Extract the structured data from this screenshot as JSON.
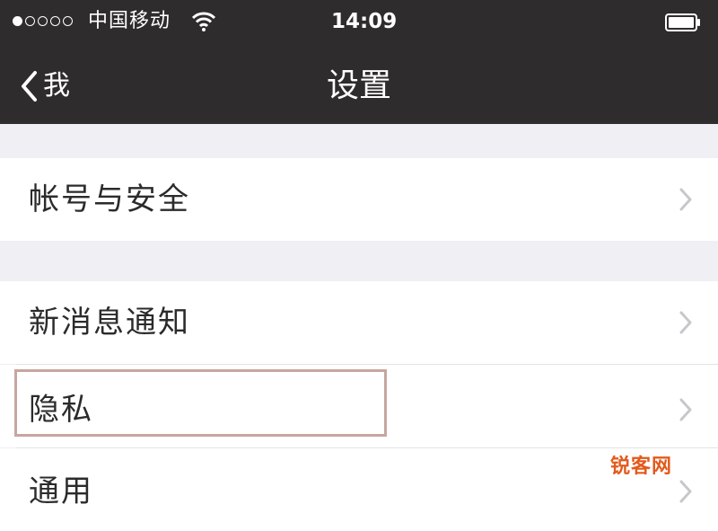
{
  "status_bar": {
    "carrier": "中国移动",
    "time": "14:09",
    "signal_filled": 1,
    "signal_total": 5
  },
  "nav": {
    "back_label": "我",
    "title": "设置"
  },
  "settings": {
    "items": [
      {
        "label": "帐号与安全"
      },
      {
        "label": "新消息通知"
      },
      {
        "label": "隐私"
      },
      {
        "label": "通用"
      }
    ]
  },
  "watermark": "锐客网",
  "colors": {
    "bar_background": "#2f2c2d",
    "page_background": "#efeff4",
    "highlight_border": "#c7a6a0",
    "watermark": "#e35a1c"
  },
  "icons": [
    "wifi-icon",
    "battery-icon",
    "back-chevron-icon",
    "chevron-right-icon"
  ]
}
